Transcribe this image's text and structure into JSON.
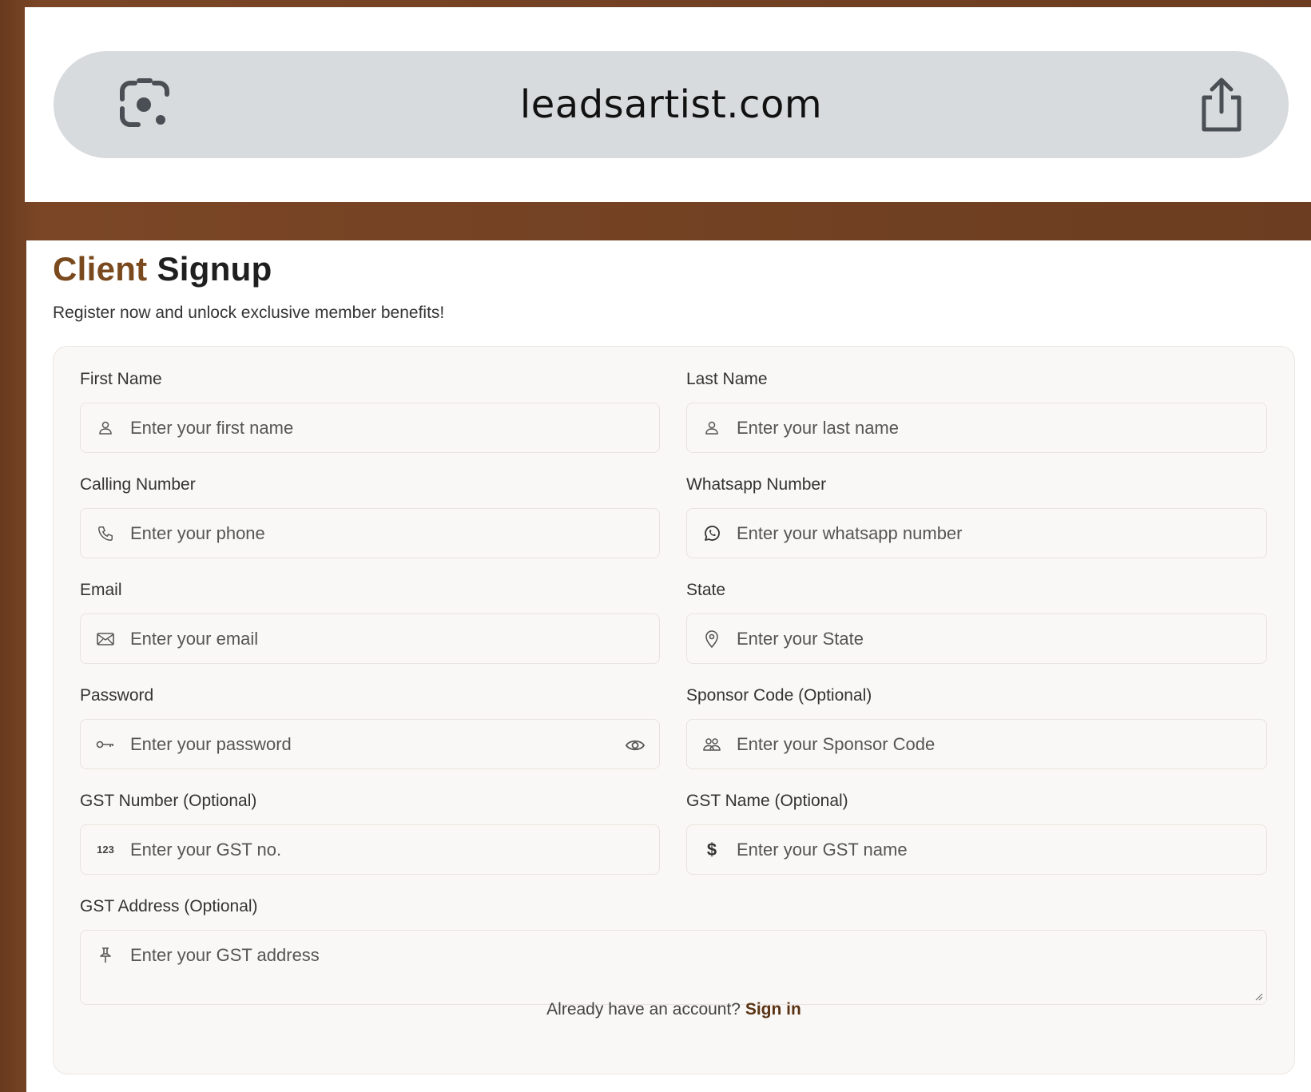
{
  "browser": {
    "url": "leadsartist.com"
  },
  "header": {
    "title_accent": "Client",
    "title_rest": "Signup",
    "subtitle": "Register now and unlock exclusive member benefits!"
  },
  "form": {
    "first_name": {
      "label": "First Name",
      "placeholder": "Enter your first name",
      "icon": "user-icon"
    },
    "last_name": {
      "label": "Last Name",
      "placeholder": "Enter your last name",
      "icon": "user-icon"
    },
    "calling_number": {
      "label": "Calling Number",
      "placeholder": "Enter your phone",
      "icon": "phone-icon"
    },
    "whatsapp_number": {
      "label": "Whatsapp Number",
      "placeholder": "Enter your whatsapp number",
      "icon": "whatsapp-icon"
    },
    "email": {
      "label": "Email",
      "placeholder": "Enter your email",
      "icon": "mail-icon"
    },
    "state": {
      "label": "State",
      "placeholder": "Enter your State",
      "icon": "location-pin-icon"
    },
    "password": {
      "label": "Password",
      "placeholder": "Enter your password",
      "icon": "key-icon"
    },
    "sponsor_code": {
      "label": "Sponsor Code (Optional)",
      "placeholder": "Enter your Sponsor Code",
      "icon": "users-icon"
    },
    "gst_number": {
      "label": "GST Number (Optional)",
      "placeholder": "Enter your GST no.",
      "icon": "numbers-icon",
      "icon_text": "123"
    },
    "gst_name": {
      "label": "GST Name (Optional)",
      "placeholder": "Enter your GST name",
      "icon": "dollar-icon",
      "icon_text": "$"
    },
    "gst_address": {
      "label": "GST Address (Optional)",
      "placeholder": "Enter your GST address",
      "icon": "pin-icon"
    }
  },
  "footer": {
    "prompt": "Already have an account? ",
    "link": "Sign in"
  },
  "colors": {
    "background": "#6b3c1f",
    "accent": "#7a4a1e",
    "card": "#faf8f6",
    "url_bar": "#d7dbdd"
  }
}
